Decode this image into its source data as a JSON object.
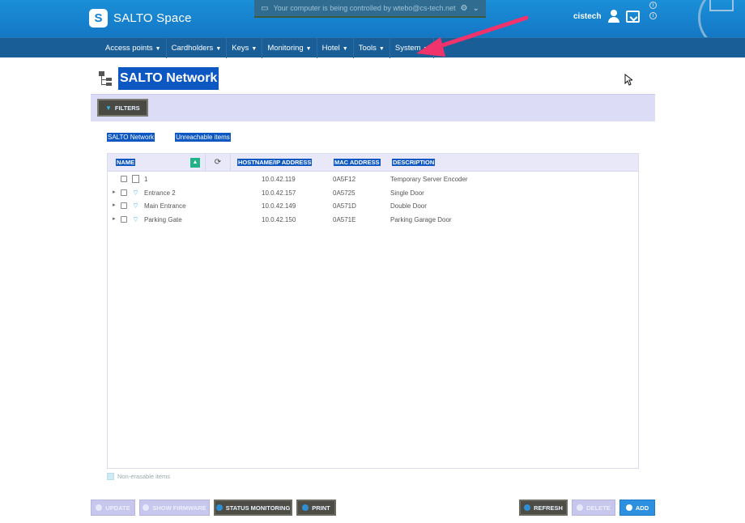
{
  "app": {
    "name": "SALTO Space",
    "logo_letter": "S"
  },
  "remote_banner": {
    "text": "Your computer is being controlled by wtebo@cs-tech.net"
  },
  "user": {
    "name": "cistech"
  },
  "nav": {
    "items": [
      {
        "label": "Access points"
      },
      {
        "label": "Cardholders"
      },
      {
        "label": "Keys"
      },
      {
        "label": "Monitoring"
      },
      {
        "label": "Hotel"
      },
      {
        "label": "Tools"
      },
      {
        "label": "System"
      }
    ]
  },
  "page": {
    "title": "SALTO Network"
  },
  "filters": {
    "label": "FILTERS"
  },
  "subtabs": [
    {
      "label": "SALTO Network"
    },
    {
      "label": "Unreachable items"
    }
  ],
  "table": {
    "columns": {
      "name": "NAME",
      "host": "HOSTNAME/IP ADDRESS",
      "mac": "MAC ADDRESS",
      "description": "DESCRIPTION"
    },
    "rows": [
      {
        "name": "1",
        "icon": "document-icon",
        "host": "10.0.42.119",
        "mac": "0A5F12",
        "description": "Temporary Server Encoder",
        "expandable": false
      },
      {
        "name": "Entrance 2",
        "icon": "wifi-icon",
        "host": "10.0.42.157",
        "mac": "0A5725",
        "description": "Single Door",
        "expandable": true
      },
      {
        "name": "Main Entrance",
        "icon": "wifi-icon",
        "host": "10.0.42.149",
        "mac": "0A571D",
        "description": "Double Door",
        "expandable": true
      },
      {
        "name": "Parking Gate",
        "icon": "wifi-icon",
        "host": "10.0.42.150",
        "mac": "0A571E",
        "description": "Parking Garage Door",
        "expandable": true
      }
    ]
  },
  "legend": {
    "label": "Non-erasable items"
  },
  "buttons": {
    "update": "UPDATE",
    "show_firmware": "SHOW FIRMWARE",
    "status_monitoring": "STATUS MONITORING",
    "print": "PRINT",
    "refresh": "REFRESH",
    "delete": "DELETE",
    "add": "ADD"
  },
  "colors": {
    "header_blue": "#1580cf",
    "nav_blue": "#1a5e98",
    "selection_blue": "#0d57c2",
    "annotation_arrow": "#f0336b"
  }
}
